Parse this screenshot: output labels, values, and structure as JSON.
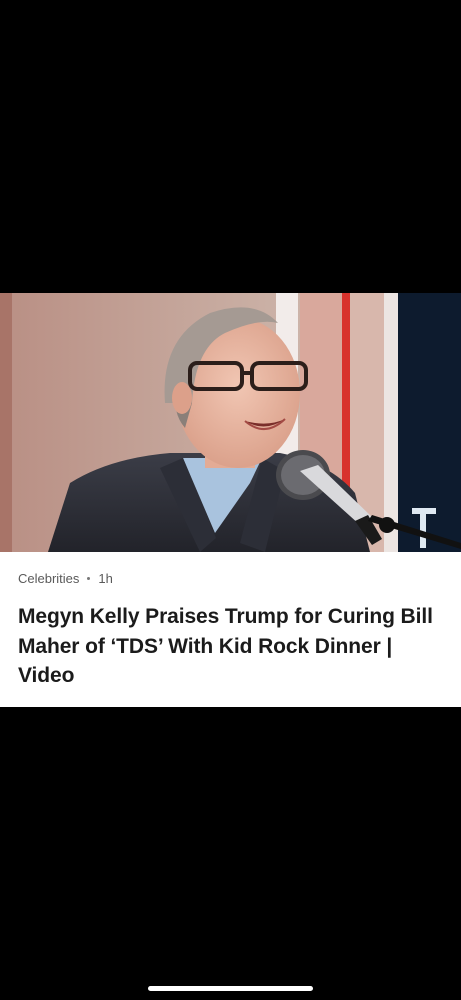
{
  "article": {
    "category": "Celebrities",
    "time_ago": "1h",
    "headline": "Megyn Kelly Praises Trump for Curing Bill Maher of ‘TDS’ With Kid Rock Dinner | Video",
    "image_description_icon": "photo-man-with-glasses-at-microphone"
  },
  "colors": {
    "background": "#000000",
    "card": "#ffffff",
    "headline": "#1b1b1b",
    "meta": "#5a5a5a"
  }
}
